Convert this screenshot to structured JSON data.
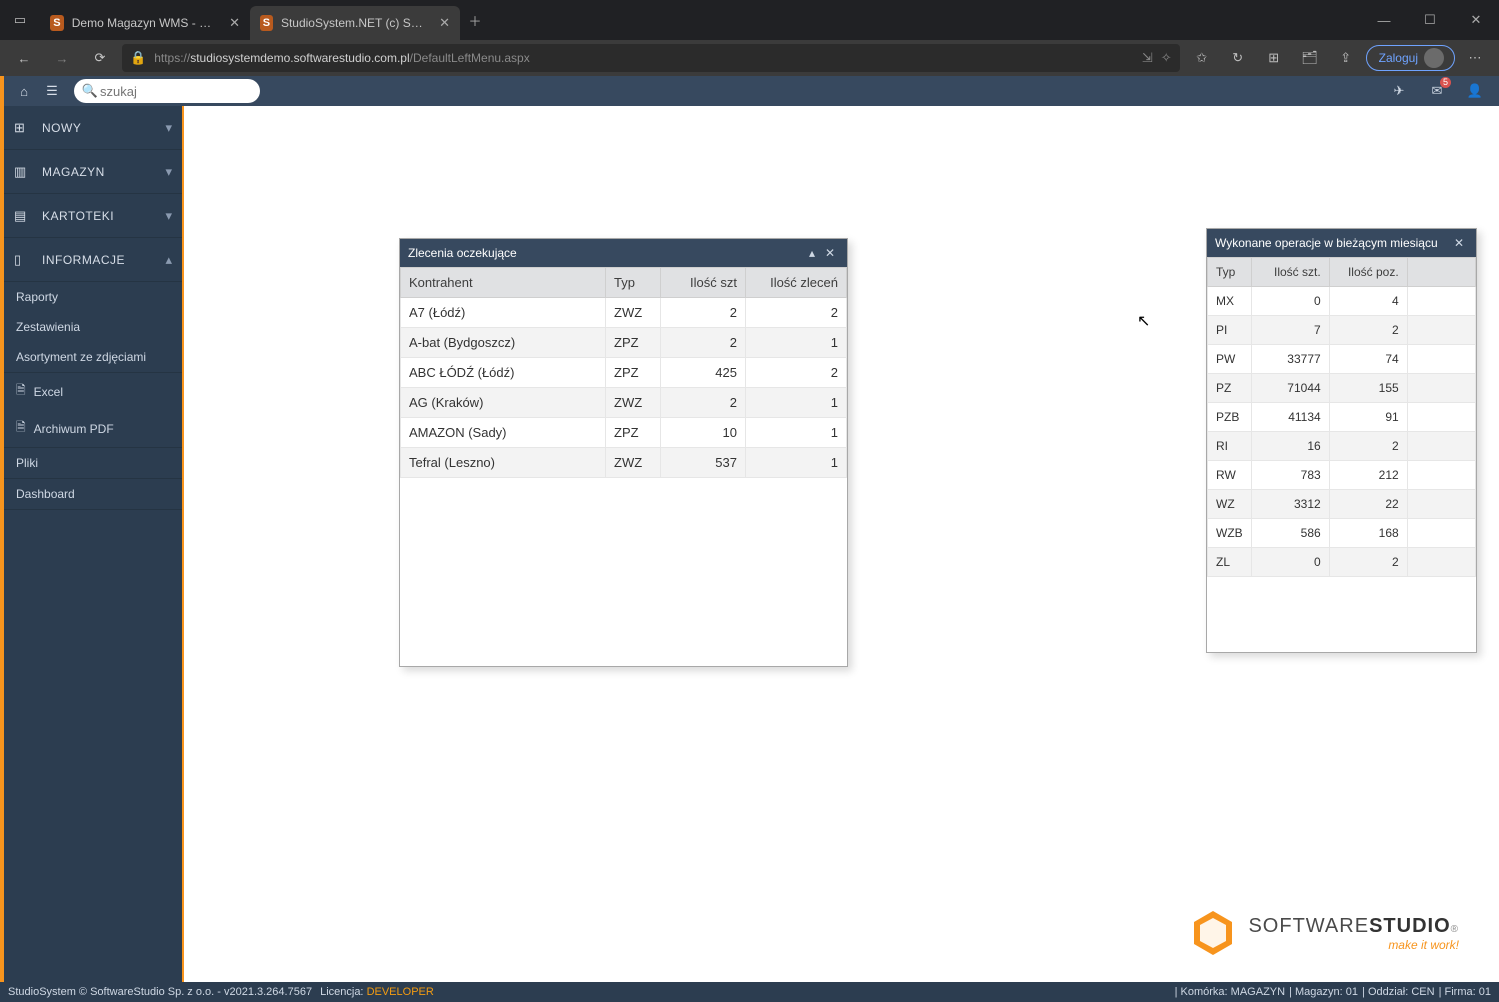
{
  "browser": {
    "tab1": "Demo Magazyn WMS - Demo o",
    "tab2": "StudioSystem.NET (c) SoftwareSt",
    "url_host": "studiosystemdemo.softwarestudio.com.pl",
    "url_path": "/DefaultLeftMenu.aspx",
    "login": "Zaloguj"
  },
  "topbar": {
    "search_placeholder": "szukaj",
    "mail_badge": "5"
  },
  "sidebar": {
    "nowy": "NOWY",
    "magazyn": "MAGAZYN",
    "kartoteki": "KARTOTEKI",
    "informacje": "INFORMACJE",
    "raporty": "Raporty",
    "zestawienia": "Zestawienia",
    "asortyment": "Asortyment ze zdjęciami",
    "excel": "Excel",
    "archiwum": "Archiwum PDF",
    "pliki": "Pliki",
    "dashboard": "Dashboard"
  },
  "widget1": {
    "title": "Zlecenia oczekujące",
    "cols": {
      "c0": "Kontrahent",
      "c1": "Typ",
      "c2": "Ilość szt",
      "c3": "Ilość zleceń"
    },
    "rows": [
      {
        "k": "A7 (Łódź)",
        "t": "ZWZ",
        "s": "2",
        "z": "2"
      },
      {
        "k": "A-bat (Bydgoszcz)",
        "t": "ZPZ",
        "s": "2",
        "z": "1"
      },
      {
        "k": "ABC ŁÓDŹ (Łódź)",
        "t": "ZPZ",
        "s": "425",
        "z": "2"
      },
      {
        "k": "AG (Kraków)",
        "t": "ZWZ",
        "s": "2",
        "z": "1"
      },
      {
        "k": "AMAZON (Sady)",
        "t": "ZPZ",
        "s": "10",
        "z": "1"
      },
      {
        "k": "Tefral (Leszno)",
        "t": "ZWZ",
        "s": "537",
        "z": "1"
      }
    ]
  },
  "widget2": {
    "title": "Wykonane operacje w bieżącym miesiącu",
    "cols": {
      "c0": "Typ",
      "c1": "Ilość szt.",
      "c2": "Ilość poz."
    },
    "rows": [
      {
        "t": "MX",
        "s": "0",
        "p": "4"
      },
      {
        "t": "PI",
        "s": "7",
        "p": "2"
      },
      {
        "t": "PW",
        "s": "33777",
        "p": "74"
      },
      {
        "t": "PZ",
        "s": "71044",
        "p": "155"
      },
      {
        "t": "PZB",
        "s": "41134",
        "p": "91"
      },
      {
        "t": "RI",
        "s": "16",
        "p": "2"
      },
      {
        "t": "RW",
        "s": "783",
        "p": "212"
      },
      {
        "t": "WZ",
        "s": "3312",
        "p": "22"
      },
      {
        "t": "WZB",
        "s": "586",
        "p": "168"
      },
      {
        "t": "ZL",
        "s": "0",
        "p": "2"
      }
    ]
  },
  "logo": {
    "brand1": "SOFTWARE",
    "brand2": "STUDIO",
    "tag": "make it work!"
  },
  "footer": {
    "copyright": "StudioSystem © SoftwareStudio Sp. z o.o. - v2021.3.264.7567",
    "lic_label": "Licencja:",
    "lic_val": "DEVELOPER",
    "komorka_l": "Komórka:",
    "komorka_v": "MAGAZYN",
    "magazyn_l": "Magazyn:",
    "magazyn_v": "01",
    "oddzial_l": "Oddział:",
    "oddzial_v": "CEN",
    "firma_l": "Firma:",
    "firma_v": "01"
  }
}
